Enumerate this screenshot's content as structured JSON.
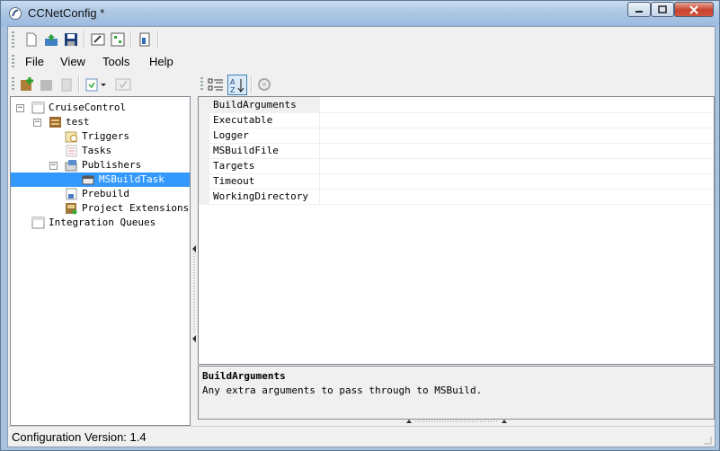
{
  "window": {
    "title": "CCNetConfig *",
    "caption_buttons": [
      "minimize-icon",
      "maximize-icon",
      "close-icon"
    ]
  },
  "toolbar": {
    "buttons": [
      "new-icon",
      "open-icon",
      "save-icon",
      "edit-icon",
      "validate-icon",
      "export-icon"
    ]
  },
  "menu": {
    "items": [
      {
        "label": "File"
      },
      {
        "label": "View"
      },
      {
        "label": "Tools"
      },
      {
        "label": "Help"
      }
    ]
  },
  "tree_toolbar": {
    "buttons": [
      "add-project-icon",
      "edit-project-icon",
      "delete-project-icon",
      "clone-dropdown-icon",
      "checklist-icon"
    ]
  },
  "tree": {
    "nodes": [
      {
        "label": "CruiseControl",
        "icon": "root-icon",
        "expander": "−"
      },
      {
        "label": "test",
        "icon": "project-icon",
        "expander": "−"
      },
      {
        "label": "Triggers",
        "icon": "triggers-icon"
      },
      {
        "label": "Tasks",
        "icon": "tasks-icon"
      },
      {
        "label": "Publishers",
        "icon": "publishers-icon",
        "expander": "−"
      },
      {
        "label": "MSBuildTask",
        "icon": "task-icon",
        "selected": true
      },
      {
        "label": "Prebuild",
        "icon": "prebuild-icon"
      },
      {
        "label": "Project Extensions",
        "icon": "extensions-icon"
      },
      {
        "label": "Integration Queues",
        "icon": "queues-icon"
      }
    ]
  },
  "property_grid": {
    "toolbar": [
      "categorized-icon",
      "alphabetical-icon",
      "property-pages-icon"
    ],
    "rows": [
      {
        "name": "BuildArguments",
        "value": ""
      },
      {
        "name": "Executable",
        "value": ""
      },
      {
        "name": "Logger",
        "value": ""
      },
      {
        "name": "MSBuildFile",
        "value": ""
      },
      {
        "name": "Targets",
        "value": ""
      },
      {
        "name": "Timeout",
        "value": ""
      },
      {
        "name": "WorkingDirectory",
        "value": ""
      }
    ],
    "description": {
      "title": "BuildArguments",
      "text": "Any extra arguments to pass through to MSBuild."
    }
  },
  "status": {
    "text": "Configuration Version: 1.4"
  },
  "colors": {
    "selection": "#3399ff",
    "title_bar": "#aec8e4",
    "close_button": "#c7422c"
  }
}
